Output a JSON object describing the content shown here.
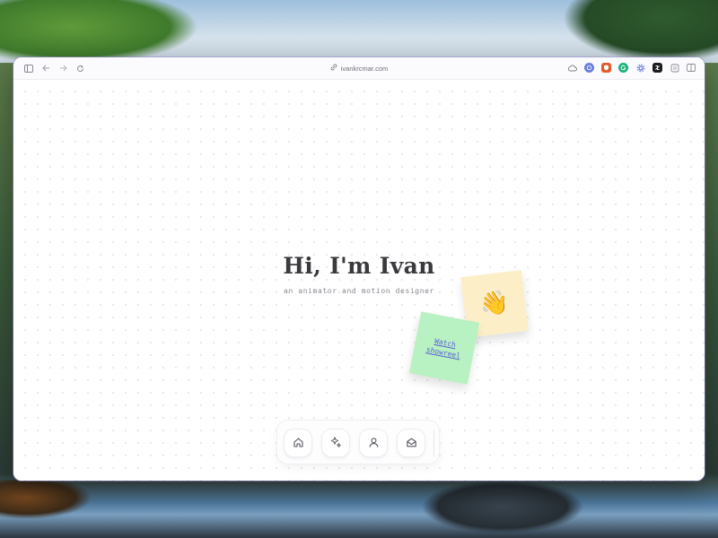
{
  "browser": {
    "url": "ivankrcmar.com"
  },
  "hero": {
    "title": "Hi, I'm Ivan",
    "subtitle": "an animator and motion designer"
  },
  "notes": {
    "wave_emoji": "👋",
    "showreel_link": "Watch showreel"
  },
  "dock": {
    "items": [
      "home-icon",
      "sparkle-icon",
      "person-icon",
      "mail-icon"
    ]
  },
  "colors": {
    "accent_link": "#5a60d8",
    "note_yellow": "#fcefc8",
    "note_green": "#b8f1c2"
  }
}
